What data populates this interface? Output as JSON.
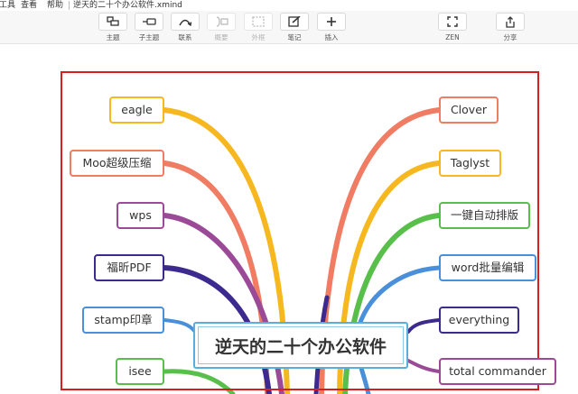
{
  "menu": {
    "tools": "工具",
    "view": "查看",
    "help": "帮助",
    "doc_title": "逆天的二十个办公软件.xmind"
  },
  "toolbar": {
    "topic": "主题",
    "subtopic": "子主题",
    "relationship": "联系",
    "summary": "概要",
    "boundary": "外框",
    "note": "笔记",
    "insert": "插入",
    "zen": "ZEN",
    "share": "分享"
  },
  "mindmap": {
    "central": "逆天的二十个办公软件",
    "left": [
      "eagle",
      "Moo超级压缩",
      "wps",
      "福昕PDF",
      "stamp印章",
      "isee"
    ],
    "right": [
      "Clover",
      "Taglyst",
      "一键自动排版",
      "word批量编辑",
      "everything",
      "total commander"
    ],
    "colors": {
      "yellow": "#f6b81e",
      "salmon": "#ef7c63",
      "purple": "#9a4a96",
      "navy": "#3d2a8f",
      "blue": "#4a8fd9",
      "green": "#58bf4a",
      "frame": "#d81e1e",
      "central": "#5aaed8"
    }
  }
}
